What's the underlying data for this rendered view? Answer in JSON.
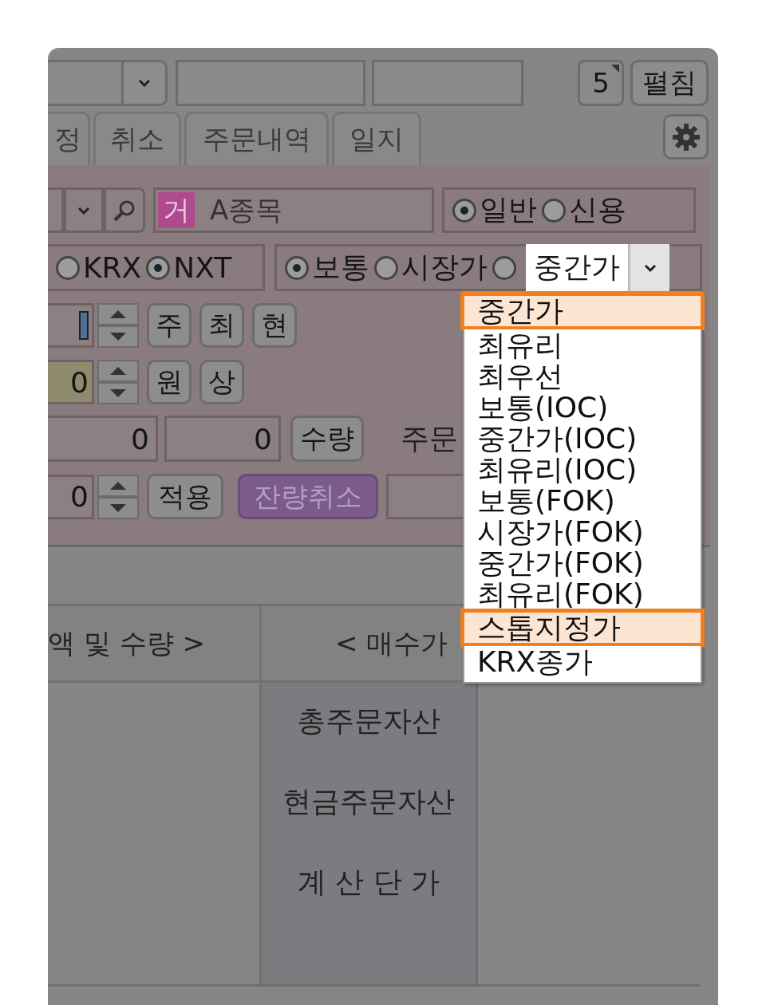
{
  "toolbar": {
    "counter": "5",
    "expand_button": "펼침"
  },
  "tabs": [
    {
      "label": "정",
      "selected": false
    },
    {
      "label": "취소",
      "selected": false
    },
    {
      "label": "주문내역",
      "selected": false
    },
    {
      "label": "일지",
      "selected": false
    }
  ],
  "order_form": {
    "stock": {
      "market_badge": "거",
      "name": "A종목"
    },
    "account_type": [
      {
        "label": "일반",
        "selected": true
      },
      {
        "label": "신용",
        "selected": false
      }
    ],
    "exchange": [
      {
        "label": "KRX",
        "selected": false
      },
      {
        "label": "NXT",
        "selected": true
      }
    ],
    "price_type": [
      {
        "label": "보통",
        "selected": true
      },
      {
        "label": "시장가",
        "selected": false
      },
      {
        "selected": false
      }
    ],
    "price_type_combo": {
      "value": "중간가"
    },
    "quantity_row": {
      "buttons": [
        "주",
        "최",
        "현"
      ]
    },
    "price_row": {
      "value": "0",
      "buttons": [
        "원",
        "상"
      ]
    },
    "amount_row": {
      "values": [
        "0",
        "0"
      ],
      "button": "수량",
      "label": "주문"
    },
    "apply_row": {
      "value": "0",
      "apply_button": "적용",
      "cancel_button": "잔량취소"
    }
  },
  "table": {
    "header": [
      "액 및 수량 >",
      "< 매수가"
    ],
    "labels": [
      "총주문자산",
      "현금주문자산",
      "계 산 단 가"
    ]
  },
  "dropdown": {
    "items": [
      {
        "label": "중간가",
        "highlighted": true
      },
      {
        "label": "최유리",
        "highlighted": false
      },
      {
        "label": "최우선",
        "highlighted": false
      },
      {
        "label": "보통(IOC)",
        "highlighted": false
      },
      {
        "label": "중간가(IOC)",
        "highlighted": false
      },
      {
        "label": "최유리(IOC)",
        "highlighted": false
      },
      {
        "label": "보통(FOK)",
        "highlighted": false
      },
      {
        "label": "시장가(FOK)",
        "highlighted": false
      },
      {
        "label": "중간가(FOK)",
        "highlighted": false
      },
      {
        "label": "최유리(FOK)",
        "highlighted": false
      },
      {
        "label": "스톱지정가",
        "highlighted": true
      },
      {
        "label": "KRX종가",
        "highlighted": false
      }
    ]
  }
}
